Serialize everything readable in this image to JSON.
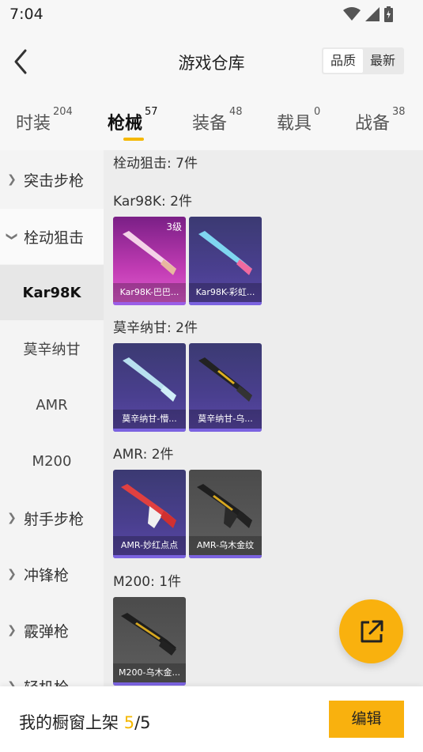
{
  "status_bar": {
    "time": "7:04"
  },
  "header": {
    "title": "游戏仓库",
    "sort": {
      "quality": "品质",
      "newest": "最新"
    }
  },
  "tabs": [
    {
      "label": "时装",
      "count": "204"
    },
    {
      "label": "枪械",
      "count": "57"
    },
    {
      "label": "装备",
      "count": "48"
    },
    {
      "label": "载具",
      "count": "0"
    },
    {
      "label": "战备",
      "count": "38"
    }
  ],
  "sidebar": {
    "items": [
      {
        "label": "突击步枪"
      },
      {
        "label": "栓动狙击"
      },
      {
        "label": "Kar98K"
      },
      {
        "label": "莫辛纳甘"
      },
      {
        "label": "AMR"
      },
      {
        "label": "M200"
      },
      {
        "label": "射手步枪"
      },
      {
        "label": "冲锋枪"
      },
      {
        "label": "霰弹枪"
      },
      {
        "label": "轻机枪"
      }
    ]
  },
  "content": {
    "category_header": "栓动狙击: 7件",
    "sections": [
      {
        "title": "Kar98K: 2件",
        "items": [
          {
            "name": "Kar98K-巴巴...",
            "level": "3级",
            "color": "#c23cb4"
          },
          {
            "name": "Kar98K-彩虹...",
            "color": "#4a3f8f"
          }
        ]
      },
      {
        "title": "莫辛纳甘: 2件",
        "items": [
          {
            "name": "莫辛纳甘-懵...",
            "color": "#4a3f8f"
          },
          {
            "name": "莫辛纳甘-乌...",
            "color": "#4a3f8f"
          }
        ]
      },
      {
        "title": "AMR: 2件",
        "items": [
          {
            "name": "AMR-妙红点点",
            "color": "#4a3f8f"
          },
          {
            "name": "AMR-乌木金纹",
            "color": "#5e5e5e"
          }
        ]
      },
      {
        "title": "M200: 1件",
        "items": [
          {
            "name": "M200-乌木金...",
            "color": "#5e5e5e"
          }
        ]
      }
    ]
  },
  "footer": {
    "label": "我的橱窗上架",
    "current": "5",
    "total": "/5",
    "edit_label": "编辑"
  },
  "colors": {
    "accent": "#f9b10e",
    "rarity_purple": "#7b63e0"
  }
}
